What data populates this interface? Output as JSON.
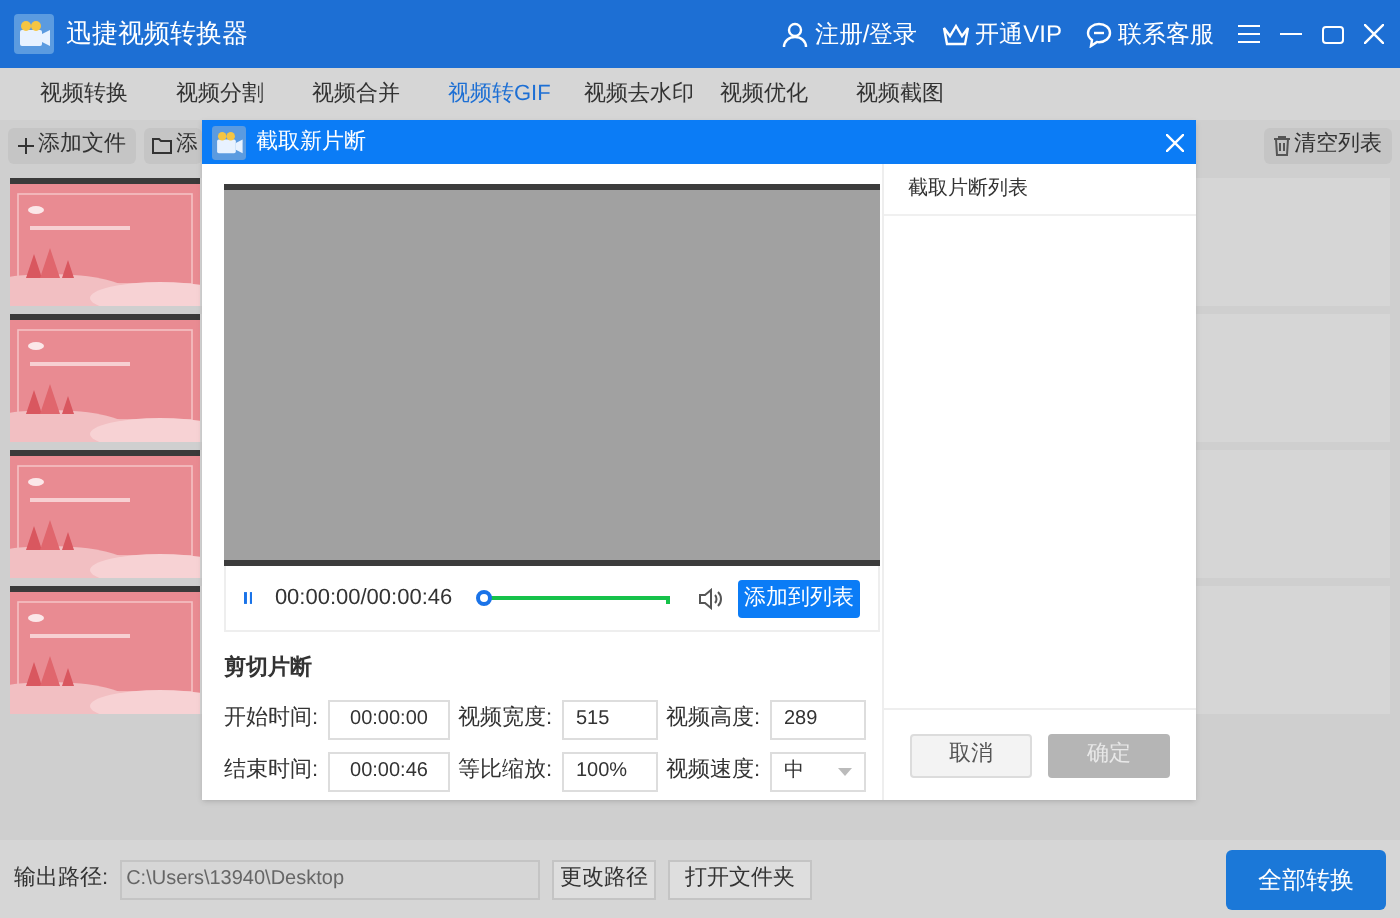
{
  "window": {
    "title": "迅捷视频转换器",
    "links": [
      "注册/登录",
      "开通VIP",
      "联系客服"
    ]
  },
  "tabs": [
    {
      "label": "视频转换",
      "selected": false
    },
    {
      "label": "视频分割",
      "selected": false
    },
    {
      "label": "视频合并",
      "selected": false
    },
    {
      "label": "视频转GIF",
      "selected": true
    },
    {
      "label": "视频去水印",
      "selected": false
    },
    {
      "label": "视频优化",
      "selected": false
    },
    {
      "label": "视频截图",
      "selected": false
    }
  ],
  "toolbar": {
    "buttons": [
      "添加文件",
      "添"
    ],
    "clear": "清空列表"
  },
  "dialog": {
    "title": "截取新片断",
    "player": {
      "time": "00:00:00/00:00:46",
      "level": 0,
      "add_button": "添加到列表"
    },
    "trim": {
      "heading": "剪切片断",
      "fields": [
        {
          "label": "开始时间:",
          "value": "00:00:00",
          "kind": "text"
        },
        {
          "label": "视频宽度:",
          "value": "515",
          "kind": "text"
        },
        {
          "label": "视频高度:",
          "value": "289",
          "kind": "text"
        },
        {
          "label": "结束时间:",
          "value": "00:00:46",
          "kind": "text"
        },
        {
          "label": "等比缩放:",
          "value": "100%",
          "kind": "text"
        },
        {
          "label": "视频速度:",
          "value": "中",
          "kind": "select"
        }
      ]
    },
    "list_title": "截取片断列表",
    "buttons": [
      {
        "label": "取消",
        "disabled": false
      },
      {
        "label": "确定",
        "disabled": true
      }
    ]
  },
  "bottom": {
    "label": "输出路径:",
    "path": "C:\\Users\\13940\\Desktop",
    "buttons": [
      "更改路径",
      "打开文件夹"
    ],
    "convert": "全部转换"
  }
}
